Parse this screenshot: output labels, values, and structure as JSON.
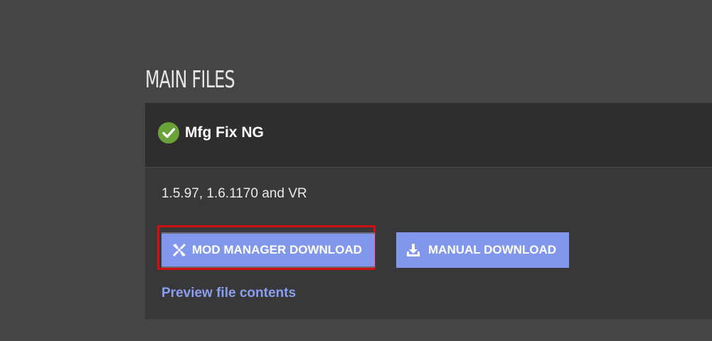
{
  "section": {
    "title": "MAIN FILES"
  },
  "file": {
    "name": "Mfg Fix NG",
    "status_icon": "check-circle-icon",
    "game_versions": "1.5.97, 1.6.1170 and VR"
  },
  "actions": {
    "mod_manager_label": "MOD MANAGER DOWNLOAD",
    "mod_manager_icon": "vortex-icon",
    "manual_label": "MANUAL DOWNLOAD",
    "manual_icon": "download-icon",
    "preview_label": "Preview file contents"
  },
  "colors": {
    "background": "#454545",
    "card": "#383838",
    "header": "#2e2e2e",
    "button": "#8197ec",
    "link": "#8a9ef0",
    "check": "#6aa33a",
    "highlight": "#d01010"
  }
}
